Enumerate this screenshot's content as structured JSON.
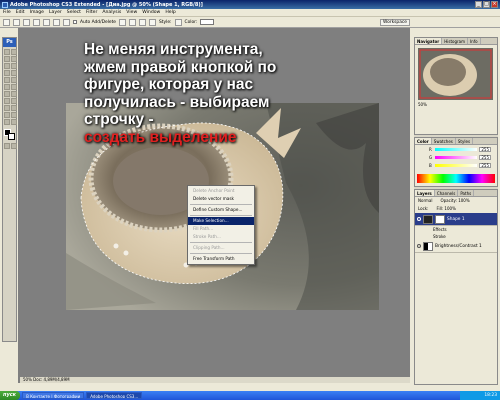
{
  "window": {
    "title": "Adobe Photoshop CS3 Extended - [Диа.jpg @ 50% (Shape 1, RGB/8)]",
    "controls": [
      "_",
      "□",
      "×"
    ]
  },
  "menu": [
    "File",
    "Edit",
    "Image",
    "Layer",
    "Select",
    "Filter",
    "Analysis",
    "View",
    "Window",
    "Help"
  ],
  "options_bar": {
    "auto_add_delete": "Auto Add/Delete",
    "style_label": "Style:",
    "color_label": "Color:",
    "workspace": "Workspace"
  },
  "tools": {
    "logo": "Ps"
  },
  "document": {
    "tab_title": "Диа.jpg @ 50% (Shape 1, RGB/8)",
    "status": "50%   Doc: 4,89M/4,89M"
  },
  "overlay": {
    "line1": "Не меняя инструмента,",
    "line2": "жмем правой кнопкой по",
    "line3": "фигуре, которая у нас",
    "line4": "получилась - выбираем",
    "line5": "строчку -",
    "line6": "создать выделение"
  },
  "context_menu": {
    "items": [
      {
        "label": "Delete Anchor Point",
        "enabled": false
      },
      {
        "label": "Delete vector mask",
        "enabled": true
      },
      {
        "label": "Define Custom Shape...",
        "enabled": true
      },
      {
        "label": "Make Selection...",
        "enabled": true,
        "selected": true
      },
      {
        "label": "Fill Path...",
        "enabled": false
      },
      {
        "label": "Stroke Path...",
        "enabled": false
      },
      {
        "label": "Clipping Path...",
        "enabled": false
      },
      {
        "label": "Free Transform Path",
        "enabled": true
      }
    ]
  },
  "panels": {
    "navigator_tabs": [
      "Navigator",
      "Histogram",
      "Info"
    ],
    "navigator_zoom": "50%",
    "color_tabs": [
      "Color",
      "Swatches",
      "Styles"
    ],
    "color_rows": [
      {
        "ch": "R",
        "val": "255"
      },
      {
        "ch": "G",
        "val": "255"
      },
      {
        "ch": "B",
        "val": "255"
      }
    ],
    "layers_tabs": [
      "Layers",
      "Channels",
      "Paths"
    ],
    "blend_mode": "Normal",
    "opacity_label": "Opacity: 100%",
    "lock_label": "Lock:",
    "fill_label": "Fill: 100%",
    "layers": [
      {
        "name": "Shape 1",
        "selected": true
      },
      {
        "name": "Effects",
        "sub": true
      },
      {
        "name": "Stroke",
        "sub": true
      },
      {
        "name": "Brightness/Contrast 1",
        "selected": false
      }
    ]
  },
  "taskbar": {
    "start": "пуск",
    "tasks": [
      "В Контакте | Фотографии",
      "Adobe Photoshop CS3..."
    ],
    "clock": "18:23"
  }
}
